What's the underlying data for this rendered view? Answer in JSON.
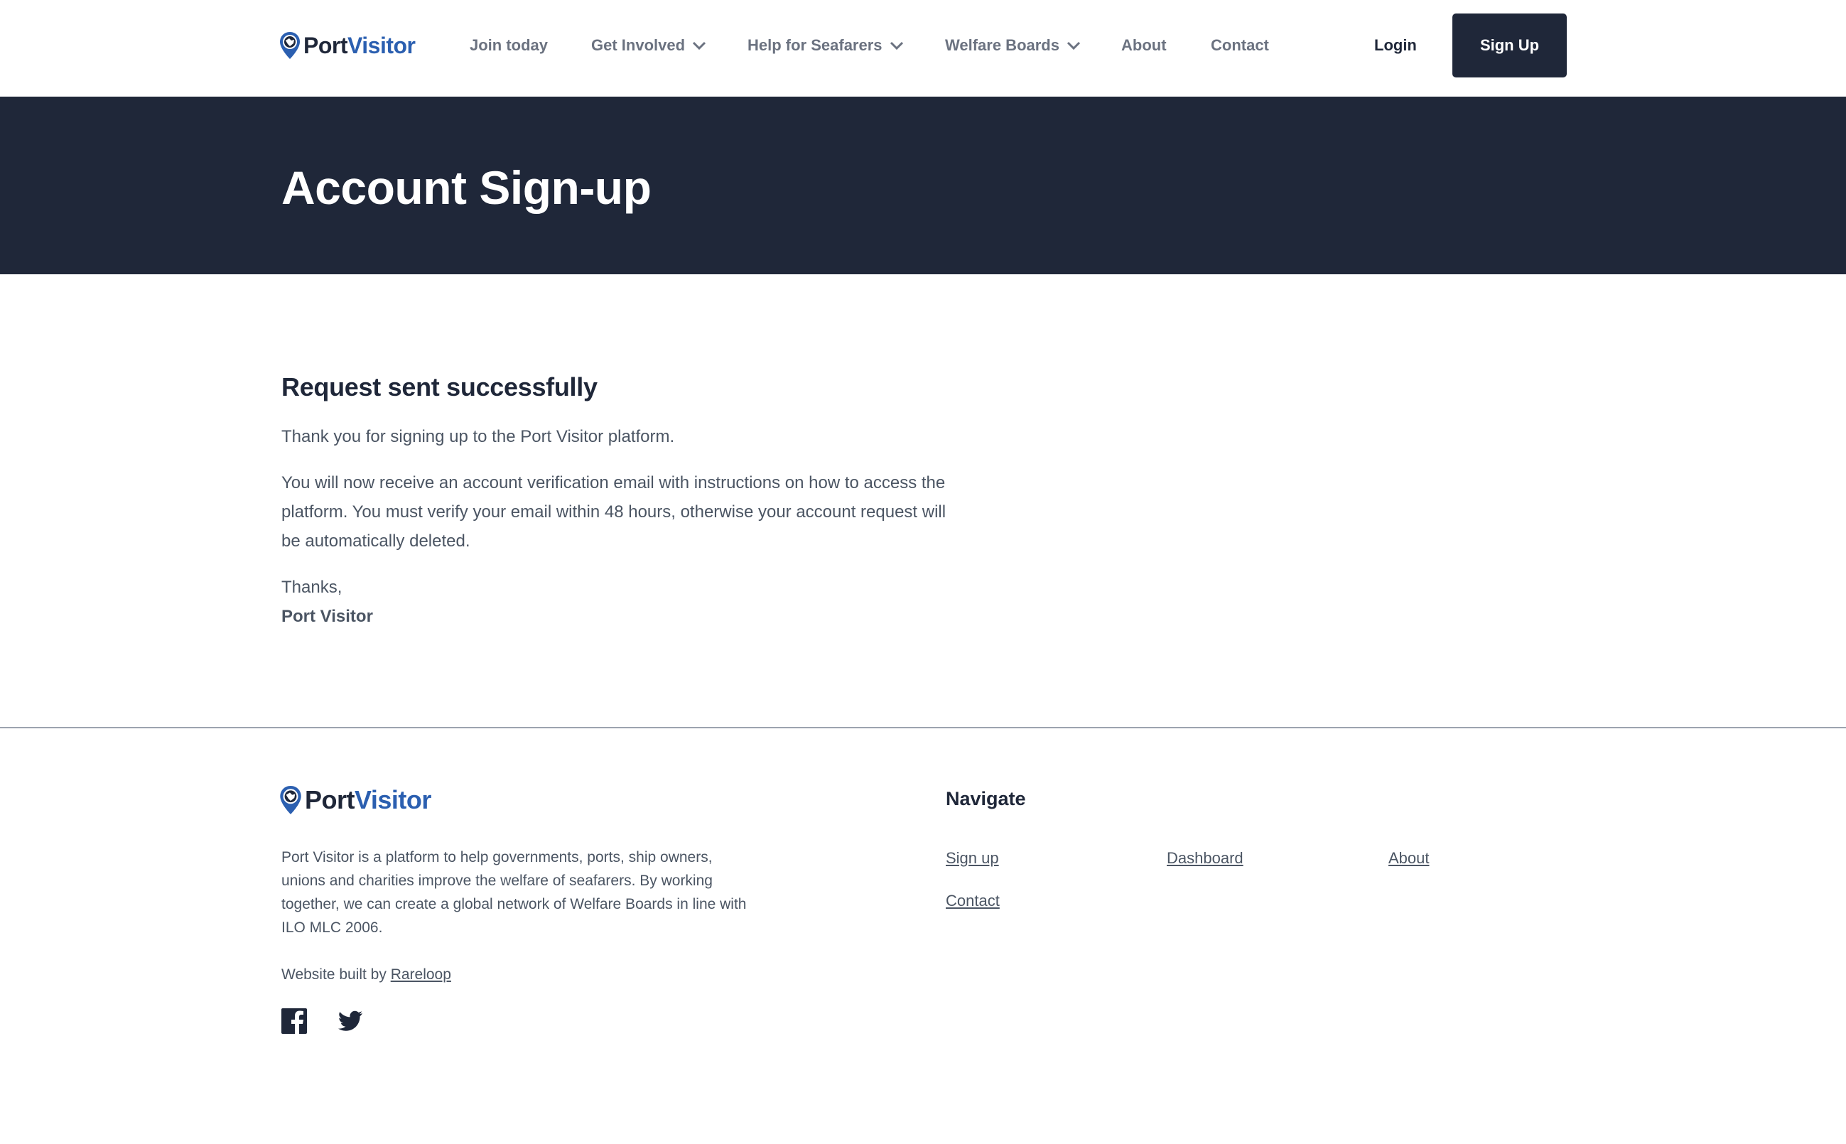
{
  "brand": {
    "part1": "Port",
    "part2": "Visitor"
  },
  "nav": {
    "join": "Join today",
    "involved": "Get Involved",
    "seafarers": "Help for Seafarers",
    "welfare": "Welfare Boards",
    "about": "About",
    "contact": "Contact"
  },
  "auth": {
    "login": "Login",
    "signup": "Sign Up"
  },
  "banner": {
    "title": "Account Sign-up"
  },
  "main": {
    "heading": "Request sent successfully",
    "p1": "Thank you for signing up to the Port Visitor platform.",
    "p2_line1": "You will now receive an account verification email with instructions on how to access the",
    "p2_line2": "platform. You must verify your email within 48 hours, otherwise your account request will",
    "p2_line3": "be automatically deleted.",
    "thanks": "Thanks,",
    "signature": "Port Visitor"
  },
  "footer": {
    "desc_line1": "Port Visitor is a platform to help governments, ports, ship owners,",
    "desc_line2": "unions and charities improve the welfare of seafarers. By working",
    "desc_line3": "together, we can create a global network of Welfare Boards in line with",
    "desc_line4": "ILO MLC 2006.",
    "built_prefix": "Website built by ",
    "built_link": "Rareloop",
    "nav_title": "Navigate",
    "links": {
      "signup": "Sign up",
      "dashboard": "Dashboard",
      "about": "About",
      "contact": "Contact"
    }
  },
  "icons": {
    "logo": "map-pin-globe-icon",
    "chevron": "chevron-down-icon",
    "facebook": "facebook-icon",
    "twitter": "twitter-icon"
  },
  "colors": {
    "navy": "#1f2739",
    "brand_blue": "#2b5fb0",
    "text_gray": "#4b5563"
  }
}
